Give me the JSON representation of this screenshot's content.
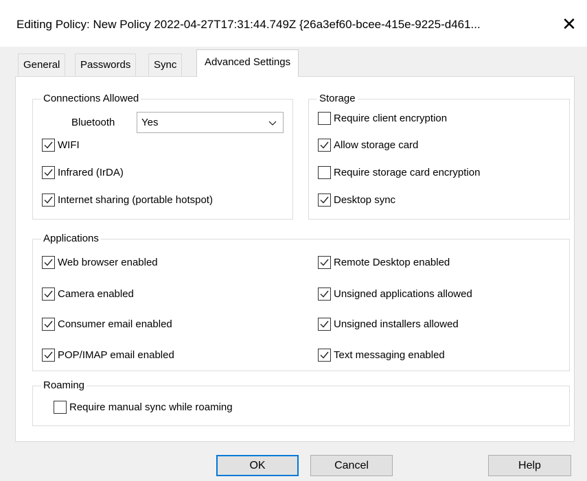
{
  "window": {
    "title": "Editing Policy:  New Policy 2022-04-27T17:31:44.749Z {26a3ef60-bcee-415e-9225-d461...",
    "close_glyph": "✕"
  },
  "tabs": [
    {
      "label": "General"
    },
    {
      "label": "Passwords"
    },
    {
      "label": "Sync"
    },
    {
      "label": "Advanced Settings",
      "active": true
    }
  ],
  "connections": {
    "legend": "Connections Allowed",
    "bluetooth_label": "Bluetooth",
    "bluetooth_value": "Yes",
    "wifi": {
      "label": "WIFI",
      "checked": true
    },
    "infrared": {
      "label": "Infrared (IrDA)",
      "checked": true
    },
    "internet_sharing": {
      "label": "Internet sharing (portable hotspot)",
      "checked": true
    }
  },
  "storage": {
    "legend": "Storage",
    "require_client_encryption": {
      "label": "Require client encryption",
      "checked": false
    },
    "allow_storage_card": {
      "label": "Allow storage card",
      "checked": true
    },
    "require_storage_card_encryption": {
      "label": "Require storage card encryption",
      "checked": false
    },
    "desktop_sync": {
      "label": "Desktop sync",
      "checked": true
    }
  },
  "applications": {
    "legend": "Applications",
    "web_browser": {
      "label": "Web browser enabled",
      "checked": true
    },
    "camera": {
      "label": "Camera enabled",
      "checked": true
    },
    "consumer_email": {
      "label": "Consumer email enabled",
      "checked": true
    },
    "pop_imap": {
      "label": "POP/IMAP email enabled",
      "checked": true
    },
    "remote_desktop": {
      "label": "Remote Desktop enabled",
      "checked": true
    },
    "unsigned_apps": {
      "label": "Unsigned applications allowed",
      "checked": true
    },
    "unsigned_installers": {
      "label": "Unsigned installers allowed",
      "checked": true
    },
    "text_messaging": {
      "label": "Text messaging enabled",
      "checked": true
    }
  },
  "roaming": {
    "legend": "Roaming",
    "manual_sync": {
      "label": "Require manual sync while roaming",
      "checked": false
    }
  },
  "buttons": {
    "ok": "OK",
    "cancel": "Cancel",
    "help": "Help"
  },
  "colors": {
    "default_button_border": "#0078d7",
    "dialog_background": "#f0f0f0"
  }
}
